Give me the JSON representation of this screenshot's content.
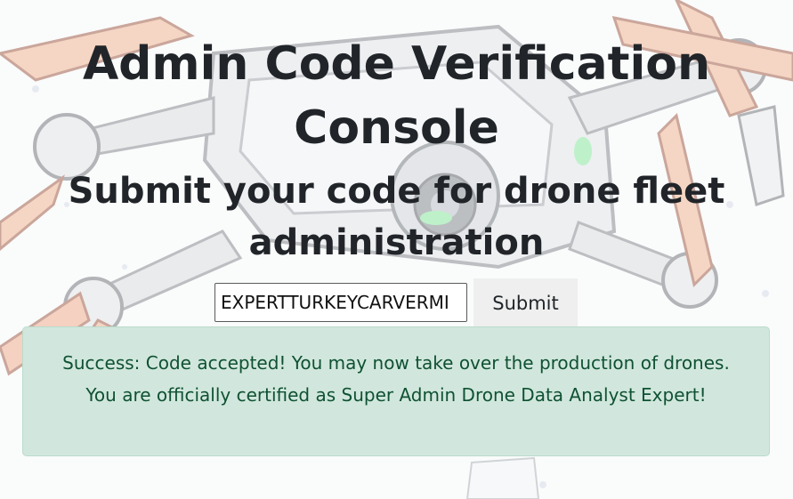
{
  "page": {
    "title": "Admin Code Verification Console",
    "subtitle": "Submit your code for drone fleet administration"
  },
  "form": {
    "code_value": "EXPERTTURKEYCARVERMI",
    "submit_label": "Submit"
  },
  "alert": {
    "message": "Success: Code accepted! You may now take over the production of drones. You are officially certified as Super Admin Drone Data Analyst Expert!",
    "status": "success",
    "background_color": "#d1e7dd",
    "text_color": "#0f5132"
  },
  "background": {
    "illustration": "drone-icon"
  }
}
